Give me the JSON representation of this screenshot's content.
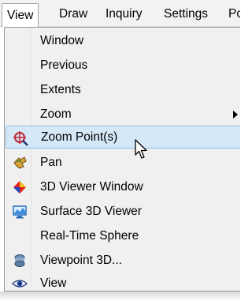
{
  "menubar": {
    "items": [
      {
        "label": "View",
        "active": true
      },
      {
        "label": "Draw"
      },
      {
        "label": "Inquiry"
      },
      {
        "label": "Settings"
      },
      {
        "label": "Pc"
      }
    ]
  },
  "view_menu": {
    "items": [
      {
        "label": "Window",
        "icon": null
      },
      {
        "label": "Previous",
        "icon": null
      },
      {
        "label": "Extents",
        "icon": null
      },
      {
        "label": "Zoom",
        "icon": null,
        "has_submenu": true
      },
      {
        "label": "Zoom Point(s)",
        "icon": "zoom-point-icon",
        "highlighted": true
      },
      {
        "label": "Pan",
        "icon": "pan-icon"
      },
      {
        "label": "3D Viewer Window",
        "icon": "3d-viewer-icon"
      },
      {
        "label": "Surface 3D Viewer",
        "icon": "surface-3d-icon"
      },
      {
        "label": "Real-Time Sphere",
        "icon": null
      },
      {
        "label": "Viewpoint 3D...",
        "icon": "viewpoint-3d-icon"
      },
      {
        "label": "View",
        "icon": "eye-icon"
      }
    ]
  },
  "colors": {
    "highlight_bg": "#d5e8f8",
    "highlight_border": "#8dbfe8",
    "menu_bg": "#f0f0f0"
  }
}
